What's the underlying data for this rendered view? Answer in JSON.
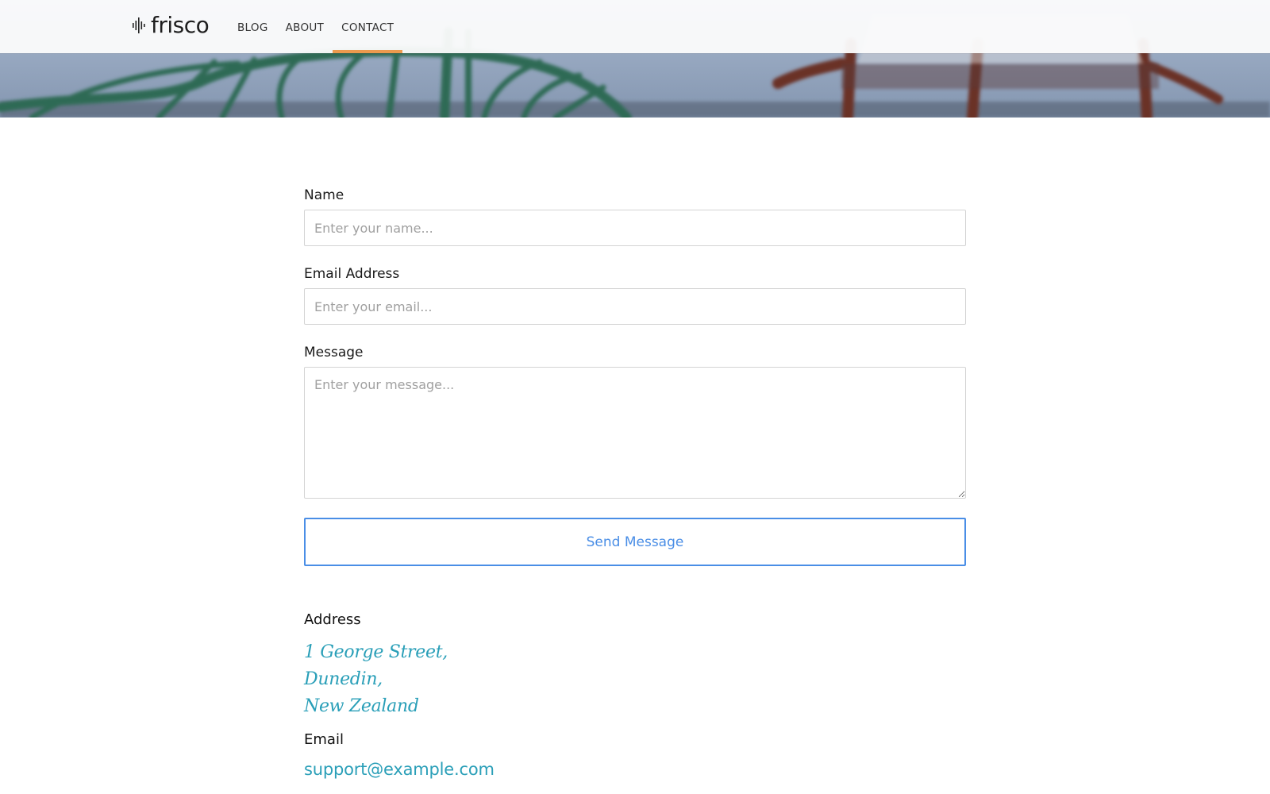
{
  "brand": {
    "name": "frisco",
    "logo_icon": "soundwave-icon"
  },
  "nav": {
    "items": [
      {
        "label": "BLOG",
        "active": false
      },
      {
        "label": "ABOUT",
        "active": false
      },
      {
        "label": "CONTACT",
        "active": true
      }
    ],
    "active_color": "#ec9a4e"
  },
  "form": {
    "name_label": "Name",
    "name_placeholder": "Enter your name...",
    "name_value": "",
    "email_label": "Email Address",
    "email_placeholder": "Enter your email...",
    "email_value": "",
    "message_label": "Message",
    "message_placeholder": "Enter your message...",
    "message_value": "",
    "submit_label": "Send Message",
    "submit_color": "#4a8ee6"
  },
  "contact_info": {
    "address_heading": "Address",
    "address_lines": [
      "1 George Street,",
      "Dunedin,",
      "New Zealand"
    ],
    "email_heading": "Email",
    "email": "support@example.com",
    "link_color": "#2a9fb8"
  }
}
